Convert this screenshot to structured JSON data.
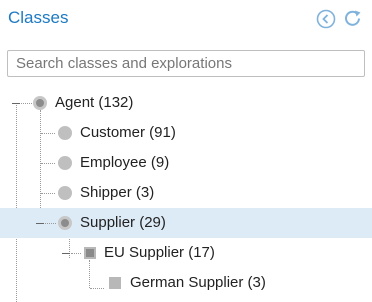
{
  "header": {
    "title": "Classes",
    "back_icon": "back-circle-icon",
    "refresh_icon": "refresh-icon",
    "accent": "#1e7ac2"
  },
  "search": {
    "placeholder": "Search classes and explorations",
    "value": ""
  },
  "tree": {
    "selected_color": "#ddebf7",
    "nodes": [
      {
        "label": "Agent (132)",
        "icon": "class-ring-node",
        "expanded": true
      },
      {
        "label": "Customer (91)",
        "icon": "class-gray-node"
      },
      {
        "label": "Employee (9)",
        "icon": "class-gray-node"
      },
      {
        "label": "Shipper (3)",
        "icon": "class-gray-node"
      },
      {
        "label": "Supplier (29)",
        "icon": "class-ring-node",
        "expanded": true,
        "selected": true
      },
      {
        "label": "EU Supplier (17)",
        "icon": "subclass-square-node",
        "expanded": true
      },
      {
        "label": "German Supplier (3)",
        "icon": "subclass-square-node"
      }
    ]
  }
}
